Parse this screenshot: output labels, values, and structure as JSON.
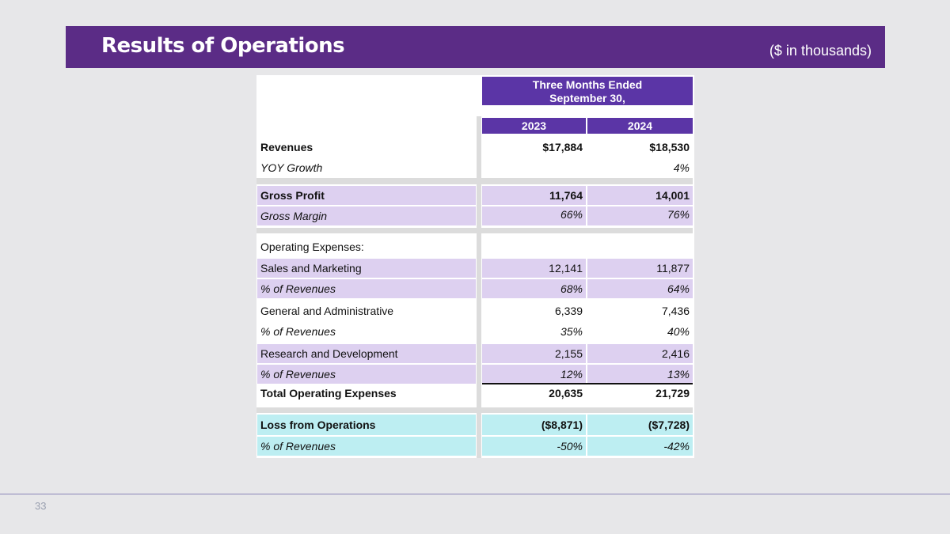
{
  "slide": {
    "title": "Results of Operations",
    "units": "($ in thousands)",
    "page_number": "33"
  },
  "table": {
    "header": {
      "period_line1": "Three Months Ended",
      "period_line2": "September 30,",
      "col1": "2023",
      "col2": "2024"
    },
    "rows": [
      {
        "label": "Revenues",
        "v1": "$17,884",
        "v2": "$18,530"
      },
      {
        "label": "YOY Growth",
        "v1": "",
        "v2": "4%"
      },
      {
        "label": "Gross Profit",
        "v1": "11,764",
        "v2": "14,001"
      },
      {
        "label": "Gross Margin",
        "v1": "66%",
        "v2": "76%"
      },
      {
        "label": "Operating Expenses:",
        "v1": "",
        "v2": ""
      },
      {
        "label": "Sales and Marketing",
        "v1": "12,141",
        "v2": "11,877"
      },
      {
        "label": "% of Revenues",
        "v1": "68%",
        "v2": "64%"
      },
      {
        "label": "General and Administrative",
        "v1": "6,339",
        "v2": "7,436"
      },
      {
        "label": "% of Revenues",
        "v1": "35%",
        "v2": "40%"
      },
      {
        "label": "Research and Development",
        "v1": "2,155",
        "v2": "2,416"
      },
      {
        "label": "% of Revenues",
        "v1": "12%",
        "v2": "13%"
      },
      {
        "label": "Total Operating Expenses",
        "v1": "20,635",
        "v2": "21,729"
      },
      {
        "label": "Loss from Operations",
        "v1": "($8,871)",
        "v2": "($7,728)"
      },
      {
        "label": "% of Revenues",
        "v1": "-50%",
        "v2": "-42%"
      }
    ]
  },
  "colors": {
    "title_bar": "#5b2c86",
    "header": "#5b35a6",
    "lavender_row": "#ddd0f0",
    "cyan_row": "#bdeef2",
    "background": "#e7e7e9"
  }
}
